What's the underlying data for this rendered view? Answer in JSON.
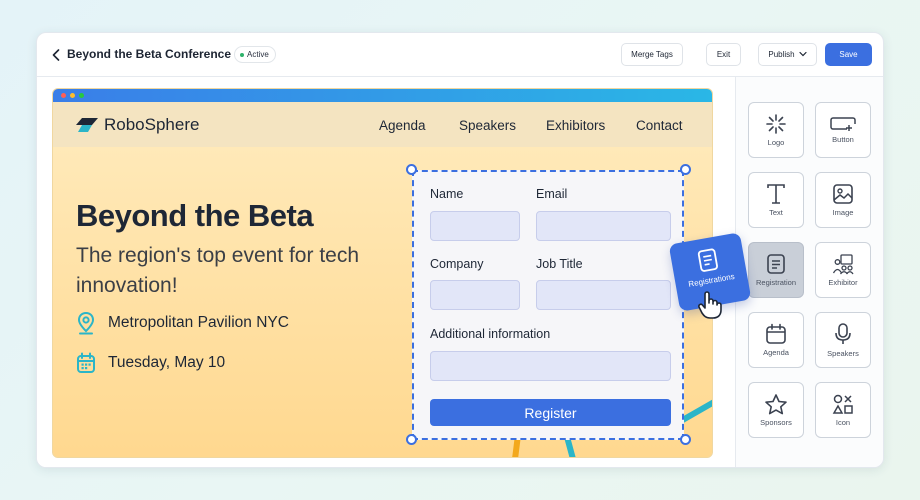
{
  "topbar": {
    "title": "Beyond the Beta Conference",
    "status": "Active",
    "merge_tags": "Merge Tags",
    "exit": "Exit",
    "publish": "Publish",
    "save": "Save"
  },
  "site": {
    "brand": "RoboSphere",
    "nav": [
      "Agenda",
      "Speakers",
      "Exhibitors",
      "Contact"
    ],
    "headline": "Beyond the Beta",
    "subheadline": "The region's top event for tech innovation!",
    "location": "Metropolitan Pavilion NYC",
    "date": "Tuesday, May 10"
  },
  "form": {
    "name_label": "Name",
    "email_label": "Email",
    "company_label": "Company",
    "job_title_label": "Job Title",
    "additional_label": "Additional information",
    "register_label": "Register"
  },
  "drag_card": {
    "label": "Registrations"
  },
  "panel": {
    "items": [
      {
        "label": "Logo",
        "icon": "logo-icon"
      },
      {
        "label": "Button",
        "icon": "button-icon"
      },
      {
        "label": "Text",
        "icon": "text-icon"
      },
      {
        "label": "Image",
        "icon": "image-icon"
      },
      {
        "label": "Registration",
        "icon": "registration-icon",
        "active": true
      },
      {
        "label": "Exhibitor",
        "icon": "exhibitor-icon"
      },
      {
        "label": "Agenda",
        "icon": "agenda-icon"
      },
      {
        "label": "Speakers",
        "icon": "speakers-icon"
      },
      {
        "label": "Sponsors",
        "icon": "sponsors-icon"
      },
      {
        "label": "Icon",
        "icon": "shapes-icon"
      }
    ]
  },
  "colors": {
    "accent": "#3b6fe0",
    "status_green": "#2fb36b",
    "hero_bg": "#ffd88f",
    "teal": "#2bb5c8"
  }
}
